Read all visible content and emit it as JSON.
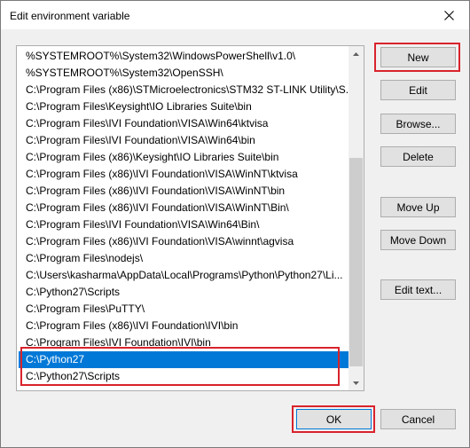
{
  "window": {
    "title": "Edit environment variable"
  },
  "paths": [
    {
      "text": "%SYSTEMROOT%\\System32\\WindowsPowerShell\\v1.0\\",
      "selected": false
    },
    {
      "text": "%SYSTEMROOT%\\System32\\OpenSSH\\",
      "selected": false
    },
    {
      "text": "C:\\Program Files (x86)\\STMicroelectronics\\STM32 ST-LINK Utility\\S...",
      "selected": false
    },
    {
      "text": "C:\\Program Files\\Keysight\\IO Libraries Suite\\bin",
      "selected": false
    },
    {
      "text": "C:\\Program Files\\IVI Foundation\\VISA\\Win64\\ktvisa",
      "selected": false
    },
    {
      "text": "C:\\Program Files\\IVI Foundation\\VISA\\Win64\\bin",
      "selected": false
    },
    {
      "text": "C:\\Program Files (x86)\\Keysight\\IO Libraries Suite\\bin",
      "selected": false
    },
    {
      "text": "C:\\Program Files (x86)\\IVI Foundation\\VISA\\WinNT\\ktvisa",
      "selected": false
    },
    {
      "text": "C:\\Program Files (x86)\\IVI Foundation\\VISA\\WinNT\\bin",
      "selected": false
    },
    {
      "text": "C:\\Program Files (x86)\\IVI Foundation\\VISA\\WinNT\\Bin\\",
      "selected": false
    },
    {
      "text": "C:\\Program Files\\IVI Foundation\\VISA\\Win64\\Bin\\",
      "selected": false
    },
    {
      "text": "C:\\Program Files (x86)\\IVI Foundation\\VISA\\winnt\\agvisa",
      "selected": false
    },
    {
      "text": "C:\\Program Files\\nodejs\\",
      "selected": false
    },
    {
      "text": "C:\\Users\\kasharma\\AppData\\Local\\Programs\\Python\\Python27\\Li...",
      "selected": false
    },
    {
      "text": "C:\\Python27\\Scripts",
      "selected": false
    },
    {
      "text": "C:\\Program Files\\PuTTY\\",
      "selected": false
    },
    {
      "text": "C:\\Program Files (x86)\\IVI Foundation\\IVI\\bin",
      "selected": false
    },
    {
      "text": "C:\\Program Files\\IVI Foundation\\IVI\\bin",
      "selected": false
    },
    {
      "text": "C:\\Python27",
      "selected": true
    },
    {
      "text": "C:\\Python27\\Scripts",
      "selected": false
    }
  ],
  "buttons": {
    "new": "New",
    "edit": "Edit",
    "browse": "Browse...",
    "delete": "Delete",
    "move_up": "Move Up",
    "move_down": "Move Down",
    "edit_text": "Edit text...",
    "ok": "OK",
    "cancel": "Cancel"
  },
  "icons": {
    "close": "close-icon",
    "scroll_up": "scroll-up-arrow-icon",
    "scroll_down": "scroll-down-arrow-icon"
  },
  "colors": {
    "selection": "#0078d7",
    "highlight_box": "#d9232c",
    "dialog_bg": "#f0f0f0"
  }
}
